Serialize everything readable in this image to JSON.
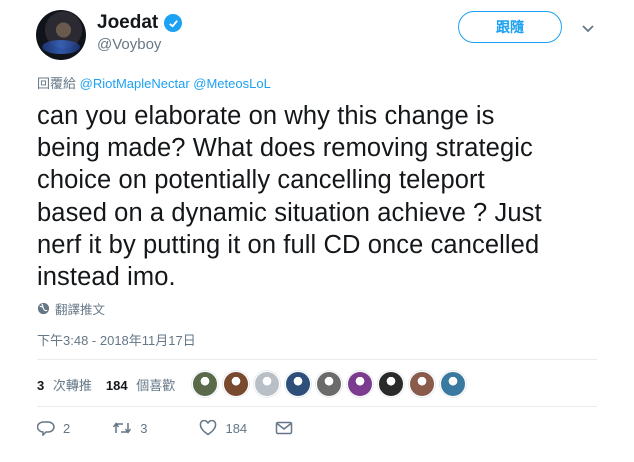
{
  "author": {
    "name": "Joedat",
    "handle": "@Voyboy"
  },
  "follow_label": "跟隨",
  "reply": {
    "prefix": "回覆給",
    "mentions": [
      "@RiotMapleNectar",
      "@MeteosLoL"
    ]
  },
  "tweet_lines": [
    "can you elaborate on why this change is",
    "being made? What does removing strategic",
    "choice on potentially cancelling teleport",
    "based on a dynamic situation achieve ? Just",
    "nerf it by putting it on full CD once cancelled",
    "instead imo."
  ],
  "translate_label": "翻譯推文",
  "timestamp": "下午3:48 - 2018年11月17日",
  "stats": {
    "retweets": "3",
    "retweets_label": "次轉推",
    "likes": "184",
    "likes_label": "個喜歡"
  },
  "liker_colors": [
    "#5b6a4a",
    "#7a4a2f",
    "#b8bfc6",
    "#2d4f7a",
    "#6b6b6b",
    "#7b3b8f",
    "#2a2a2a",
    "#8a5a4a",
    "#3a7aa0"
  ],
  "actions": {
    "replies": "2",
    "retweets": "3",
    "likes": "184"
  },
  "colors": {
    "accent": "#1da1f2",
    "muted": "#657786",
    "text": "#14171a"
  }
}
